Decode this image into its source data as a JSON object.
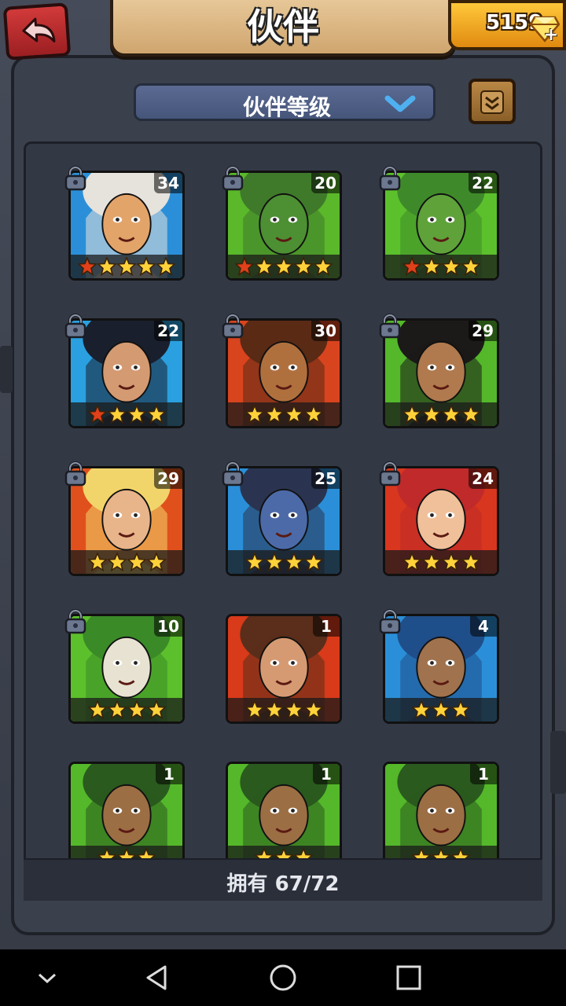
{
  "header": {
    "title": "伙伴",
    "gems": "5159",
    "back_icon": "back-arrow-icon",
    "gem_icon": "diamond-icon"
  },
  "sort": {
    "label": "伙伴等级",
    "icon": "chevron-down-icon"
  },
  "scroll_button": {
    "icon": "scroll-icon"
  },
  "partners": [
    {
      "level": "34",
      "stars": 5,
      "red_stars": 1,
      "bg": "#2a8fd8",
      "hair": "#e6e2dc",
      "skin": "#e3a46a",
      "locked": true
    },
    {
      "level": "20",
      "stars": 5,
      "red_stars": 1,
      "bg": "#5ab82a",
      "hair": "#3f7a2a",
      "skin": "#4d8f33",
      "locked": true
    },
    {
      "level": "22",
      "stars": 4,
      "red_stars": 1,
      "bg": "#5cc02c",
      "hair": "#3e8a2a",
      "skin": "#5fa23a",
      "locked": true
    },
    {
      "level": "22",
      "stars": 4,
      "red_stars": 1,
      "bg": "#2aa0e0",
      "hair": "#1a1f2e",
      "skin": "#d49a72",
      "locked": true
    },
    {
      "level": "30",
      "stars": 4,
      "red_stars": 0,
      "bg": "#d8441e",
      "hair": "#5a2a14",
      "skin": "#b0703e",
      "locked": true
    },
    {
      "level": "29",
      "stars": 4,
      "red_stars": 0,
      "bg": "#54b82a",
      "hair": "#1c1a18",
      "skin": "#b07a4e",
      "locked": true
    },
    {
      "level": "29",
      "stars": 4,
      "red_stars": 0,
      "bg": "#e0501c",
      "hair": "#f2d56a",
      "skin": "#e8b48a",
      "locked": true
    },
    {
      "level": "25",
      "stars": 4,
      "red_stars": 0,
      "bg": "#2a8fd8",
      "hair": "#2a3450",
      "skin": "#4d6aa8",
      "locked": true
    },
    {
      "level": "24",
      "stars": 4,
      "red_stars": 0,
      "bg": "#d8361e",
      "hair": "#c02a2a",
      "skin": "#f0c09a",
      "locked": true
    },
    {
      "level": "10",
      "stars": 4,
      "red_stars": 0,
      "bg": "#5cc02c",
      "hair": "#3a8a28",
      "skin": "#e8e2d2",
      "locked": true
    },
    {
      "level": "1",
      "stars": 4,
      "red_stars": 0,
      "bg": "#d83a1a",
      "hair": "#5a2e1a",
      "skin": "#d69a72",
      "locked": false
    },
    {
      "level": "4",
      "stars": 3,
      "red_stars": 0,
      "bg": "#2a8fd8",
      "hair": "#1f4f8a",
      "skin": "#a0734e",
      "locked": true
    },
    {
      "level": "1",
      "stars": 3,
      "red_stars": 0,
      "bg": "#54b82a",
      "hair": "#2a5a1e",
      "skin": "#9c6e44",
      "locked": false
    },
    {
      "level": "1",
      "stars": 3,
      "red_stars": 0,
      "bg": "#54b82a",
      "hair": "#2a5a1e",
      "skin": "#9c6e44",
      "locked": false
    },
    {
      "level": "1",
      "stars": 3,
      "red_stars": 0,
      "bg": "#54b82a",
      "hair": "#2a5a1e",
      "skin": "#9c6e44",
      "locked": false
    }
  ],
  "footer": {
    "owned": "拥有 67/72"
  },
  "nav": {
    "down_icon": "chevron-down-icon",
    "back_icon": "triangle-back-icon",
    "home_icon": "circle-home-icon",
    "recents_icon": "square-recents-icon"
  }
}
